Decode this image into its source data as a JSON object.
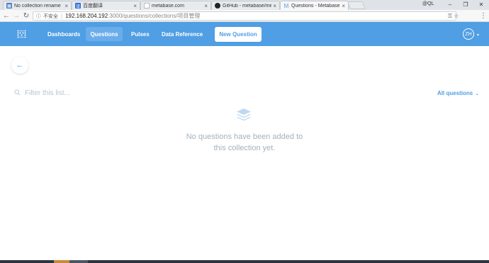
{
  "browser": {
    "tabs": [
      {
        "title": "No collection rename",
        "favicon_color": "#4a7ec4",
        "favicon_char": "▦"
      },
      {
        "title": "百度翻译",
        "favicon_color": "#2f6fd8",
        "favicon_char": "译"
      },
      {
        "title": "metabase.com",
        "favicon_color": "#ffffff",
        "favicon_char": ""
      },
      {
        "title": "GitHub - metabase/me",
        "favicon_color": "#222222",
        "favicon_char": "●"
      },
      {
        "title": "Questions - Metabase",
        "favicon_color": "#509ee3",
        "favicon_char": "M"
      }
    ],
    "profile_label": "@QL",
    "address": {
      "insecure_label": "不安全",
      "host": "192.168.204.192",
      "path": ":3000/questions/collections/项目管理"
    }
  },
  "nav": {
    "links": [
      {
        "label": "Dashboards",
        "active": false
      },
      {
        "label": "Questions",
        "active": true
      },
      {
        "label": "Pulses",
        "active": false
      },
      {
        "label": "Data Reference",
        "active": false
      }
    ],
    "new_question_label": "New Question",
    "avatar_initials": "ZH"
  },
  "content": {
    "search_placeholder": "Filter this list...",
    "filter_label": "All questions",
    "empty_line1": "No questions have been added to",
    "empty_line2": "this collection yet."
  },
  "colors": {
    "brand": "#509ee3",
    "muted_text": "#a3b1bd"
  }
}
